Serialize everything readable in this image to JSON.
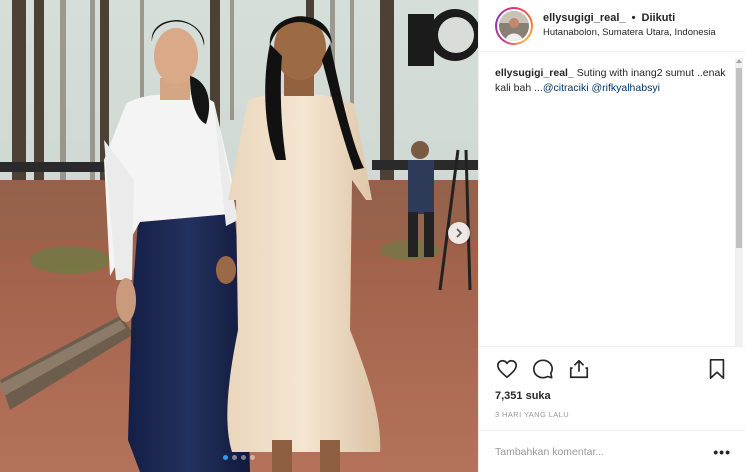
{
  "header": {
    "username": "ellysugigi_real_",
    "separator": "•",
    "follow_status": "Diikuti",
    "location": "Hutanabolon, Sumatera Utara, Indonesia"
  },
  "caption": {
    "username": "ellysugigi_real_",
    "text": "Suting with inang2 sumut ..enak kali bah ...",
    "mentions": [
      "@citraciki",
      "@rifkyalhabsyi"
    ]
  },
  "actions": {
    "like_icon": "heart-icon",
    "comment_icon": "comment-bubble-icon",
    "share_icon": "share-icon",
    "save_icon": "bookmark-icon"
  },
  "likes_count": "7,351 suka",
  "timestamp": "3 HARI YANG LALU",
  "comment_input": {
    "placeholder": "Tambahkan komentar...",
    "more_label": "•••"
  },
  "carousel": {
    "dot_count": 4,
    "active_index": 0,
    "next_icon": "chevron-right-icon",
    "accent": "#3897f0"
  }
}
